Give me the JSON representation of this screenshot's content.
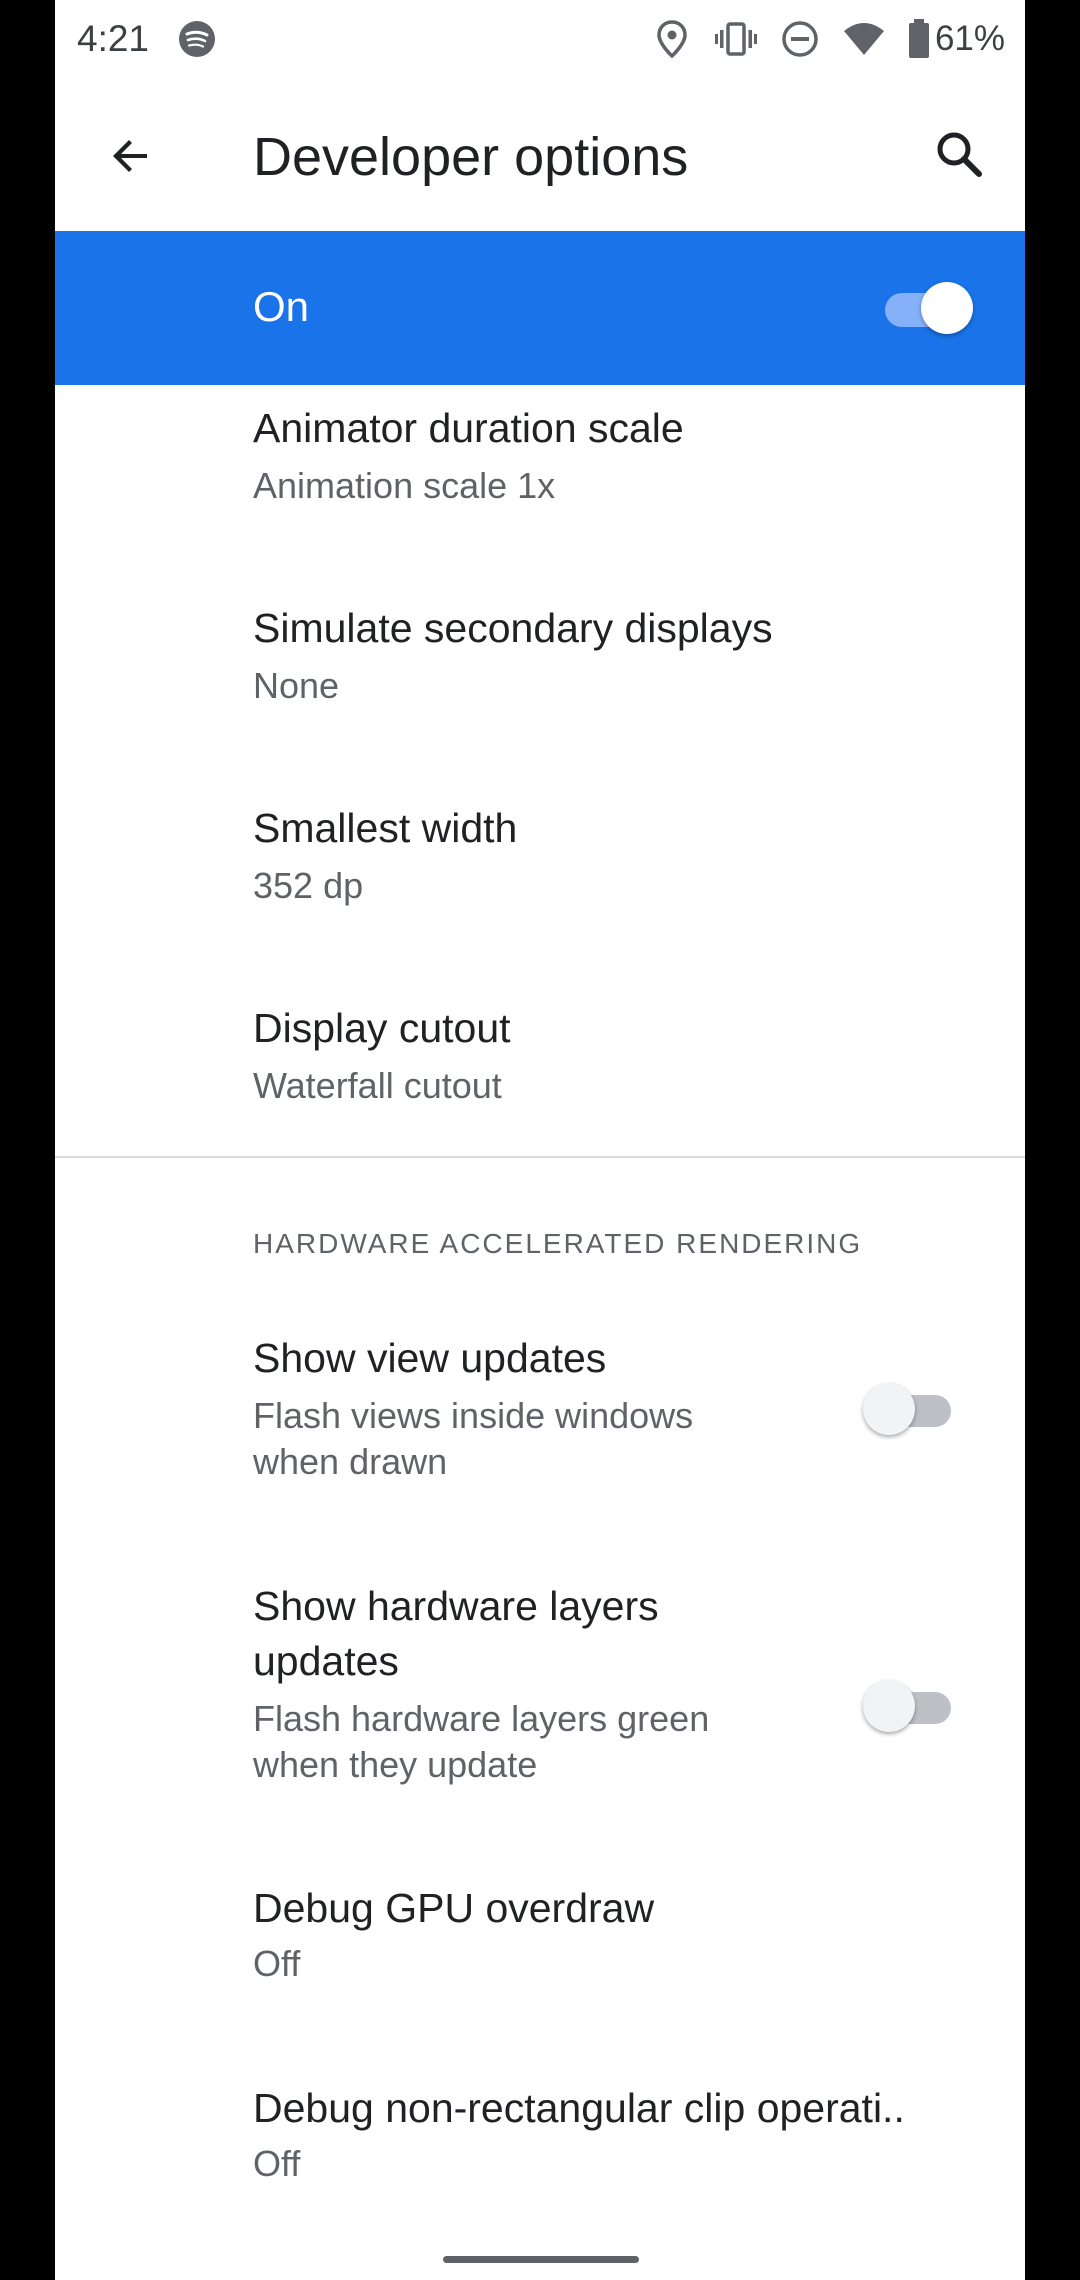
{
  "status_bar": {
    "time": "4:21",
    "battery_text": "61%",
    "icons": [
      "spotify-icon",
      "location-icon",
      "vibrate-icon",
      "do-not-disturb-icon",
      "wifi-icon",
      "battery-icon"
    ]
  },
  "app_bar": {
    "title": "Developer options",
    "back_icon": "arrow-back-icon",
    "search_icon": "search-icon"
  },
  "master_switch": {
    "label": "On",
    "checked": true,
    "accent_color": "#1a73e8"
  },
  "items_before_section": [
    {
      "title": "Animator duration scale",
      "summary": "Animation scale 1x"
    },
    {
      "title": "Simulate secondary displays",
      "summary": "None"
    },
    {
      "title": "Smallest width",
      "summary": "352 dp"
    },
    {
      "title": "Display cutout",
      "summary": "Waterfall cutout"
    }
  ],
  "section": {
    "header": "HARDWARE ACCELERATED RENDERING",
    "items": [
      {
        "title": "Show view updates",
        "summary_line1": "Flash views inside windows",
        "summary_line2": "when drawn",
        "checked": false
      },
      {
        "title_line1": "Show hardware layers",
        "title_line2": "updates",
        "summary_line1": "Flash hardware layers green",
        "summary_line2": "when they update",
        "checked": false
      },
      {
        "title": "Debug GPU overdraw",
        "summary": "Off"
      },
      {
        "title": "Debug non-rectangular clip operati..",
        "summary": "Off"
      }
    ]
  }
}
